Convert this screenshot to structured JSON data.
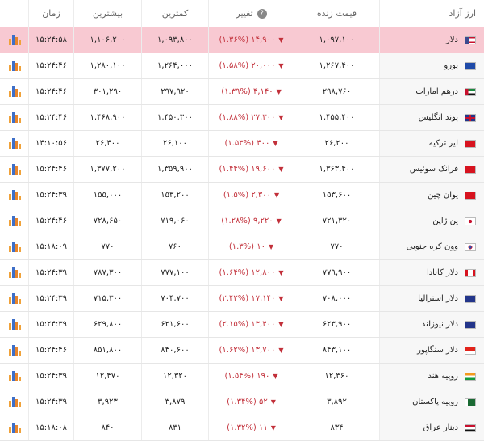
{
  "header": {
    "currency": "ارز آزاد",
    "price": "قیمت زنده",
    "change": "تغییر",
    "low": "کمترین",
    "high": "بیشترین",
    "time": "زمان"
  },
  "colors": {
    "highlight": "#f8c9d2",
    "negative": "#c2303a"
  },
  "rows": [
    {
      "name": "دلار",
      "price": "۱,۰۹۷,۱۰۰",
      "change": "۱۴,۹۰۰ (۱.۳۶%)",
      "low": "۱,۰۹۳,۸۰۰",
      "high": "۱,۱۰۶,۲۰۰",
      "time": "۱۵:۲۴:۵۸",
      "flag": "us-flag",
      "highlight": true
    },
    {
      "name": "یورو",
      "price": "۱,۲۶۷,۴۰۰",
      "change": "۲۰,۰۰۰ (۱.۵۸%)",
      "low": "۱,۲۶۴,۰۰۰",
      "high": "۱,۲۸۰,۱۰۰",
      "time": "۱۵:۲۴:۴۶",
      "flag": "eu-flag"
    },
    {
      "name": "درهم امارات",
      "price": "۲۹۸,۷۶۰",
      "change": "۴,۱۴۰ (۱.۳۹%)",
      "low": "۲۹۷,۹۲۰",
      "high": "۳۰۱,۲۹۰",
      "time": "۱۵:۲۴:۴۶",
      "flag": "ae-flag"
    },
    {
      "name": "پوند انگلیس",
      "price": "۱,۴۵۵,۴۰۰",
      "change": "۲۷,۳۰۰ (۱.۸۸%)",
      "low": "۱,۴۵۰,۳۰۰",
      "high": "۱,۴۶۸,۹۰۰",
      "time": "۱۵:۲۴:۴۶",
      "flag": "gb-flag"
    },
    {
      "name": "لیر ترکیه",
      "price": "۲۶,۲۰۰",
      "change": "۴۰۰ (۱.۵۳%)",
      "low": "۲۶,۱۰۰",
      "high": "۲۶,۴۰۰",
      "time": "۱۴:۱۰:۵۶",
      "flag": "tr-flag"
    },
    {
      "name": "فرانک سوئیس",
      "price": "۱,۳۶۳,۴۰۰",
      "change": "۱۹,۶۰۰ (۱.۴۴%)",
      "low": "۱,۳۵۹,۹۰۰",
      "high": "۱,۳۷۷,۲۰۰",
      "time": "۱۵:۲۴:۴۶",
      "flag": "ch-flag"
    },
    {
      "name": "یوان چین",
      "price": "۱۵۳,۶۰۰",
      "change": "۲,۳۰۰ (۱.۵%)",
      "low": "۱۵۳,۲۰۰",
      "high": "۱۵۵,۰۰۰",
      "time": "۱۵:۲۴:۳۹",
      "flag": "cn-flag"
    },
    {
      "name": "ین ژاپن",
      "price": "۷۲۱,۳۲۰",
      "change": "۹,۲۲۰ (۱.۲۸%)",
      "low": "۷۱۹,۰۶۰",
      "high": "۷۲۸,۶۵۰",
      "time": "۱۵:۲۴:۴۶",
      "flag": "jp-flag"
    },
    {
      "name": "وون کره جنوبی",
      "price": "۷۷۰",
      "change": "۱۰ (۱.۳%)",
      "low": "۷۶۰",
      "high": "۷۷۰",
      "time": "۱۵:۱۸:۰۹",
      "flag": "kr-flag"
    },
    {
      "name": "دلار کانادا",
      "price": "۷۷۹,۹۰۰",
      "change": "۱۲,۸۰۰ (۱.۶۴%)",
      "low": "۷۷۷,۱۰۰",
      "high": "۷۸۷,۳۰۰",
      "time": "۱۵:۲۴:۳۹",
      "flag": "ca-flag"
    },
    {
      "name": "دلار استرالیا",
      "price": "۷۰۸,۰۰۰",
      "change": "۱۷,۱۴۰ (۲.۴۲%)",
      "low": "۷۰۴,۷۰۰",
      "high": "۷۱۵,۳۰۰",
      "time": "۱۵:۲۴:۳۹",
      "flag": "au-flag"
    },
    {
      "name": "دلار نیوزلند",
      "price": "۶۲۳,۹۰۰",
      "change": "۱۳,۴۰۰ (۲.۱۵%)",
      "low": "۶۲۱,۶۰۰",
      "high": "۶۲۹,۸۰۰",
      "time": "۱۵:۲۴:۳۹",
      "flag": "nz-flag"
    },
    {
      "name": "دلار سنگاپور",
      "price": "۸۴۳,۱۰۰",
      "change": "۱۳,۷۰۰ (۱.۶۲%)",
      "low": "۸۴۰,۶۰۰",
      "high": "۸۵۱,۸۰۰",
      "time": "۱۵:۲۴:۴۶",
      "flag": "sg-flag"
    },
    {
      "name": "روپیه هند",
      "price": "۱۲,۳۶۰",
      "change": "۱۹۰ (۱.۵۴%)",
      "low": "۱۲,۳۲۰",
      "high": "۱۲,۴۷۰",
      "time": "۱۵:۲۴:۳۹",
      "flag": "in-flag"
    },
    {
      "name": "روپیه پاکستان",
      "price": "۳,۸۹۲",
      "change": "۵۲ (۱.۳۴%)",
      "low": "۳,۸۷۹",
      "high": "۳,۹۲۳",
      "time": "۱۵:۲۴:۳۹",
      "flag": "pk-flag"
    },
    {
      "name": "دینار عراق",
      "price": "۸۳۴",
      "change": "۱۱ (۱.۳۲%)",
      "low": "۸۳۱",
      "high": "۸۴۰",
      "time": "۱۵:۱۸:۰۸",
      "flag": "iq-flag"
    }
  ]
}
